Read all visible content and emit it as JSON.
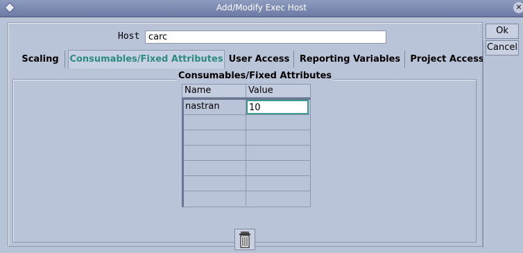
{
  "window": {
    "title": "Add/Modify Exec Host"
  },
  "host": {
    "label": "Host",
    "value": "carc"
  },
  "tabs": [
    {
      "label": "Scaling"
    },
    {
      "label": "Consumables/Fixed Attributes"
    },
    {
      "label": "User Access"
    },
    {
      "label": "Reporting Variables"
    },
    {
      "label": "Project Access"
    }
  ],
  "panel": {
    "title": "Consumables/Fixed Attributes"
  },
  "table": {
    "headers": {
      "name": "Name",
      "value": "Value"
    },
    "rows": [
      {
        "name": "nastran",
        "value": "10"
      },
      {
        "name": "",
        "value": ""
      },
      {
        "name": "",
        "value": ""
      },
      {
        "name": "",
        "value": ""
      },
      {
        "name": "",
        "value": ""
      },
      {
        "name": "",
        "value": ""
      },
      {
        "name": "",
        "value": ""
      }
    ]
  },
  "buttons": {
    "ok": "Ok",
    "cancel": "Cancel"
  },
  "colors": {
    "active_tab": "#2b8a83",
    "titlebar": "#7d8ab3",
    "background": "#bac4d8"
  }
}
